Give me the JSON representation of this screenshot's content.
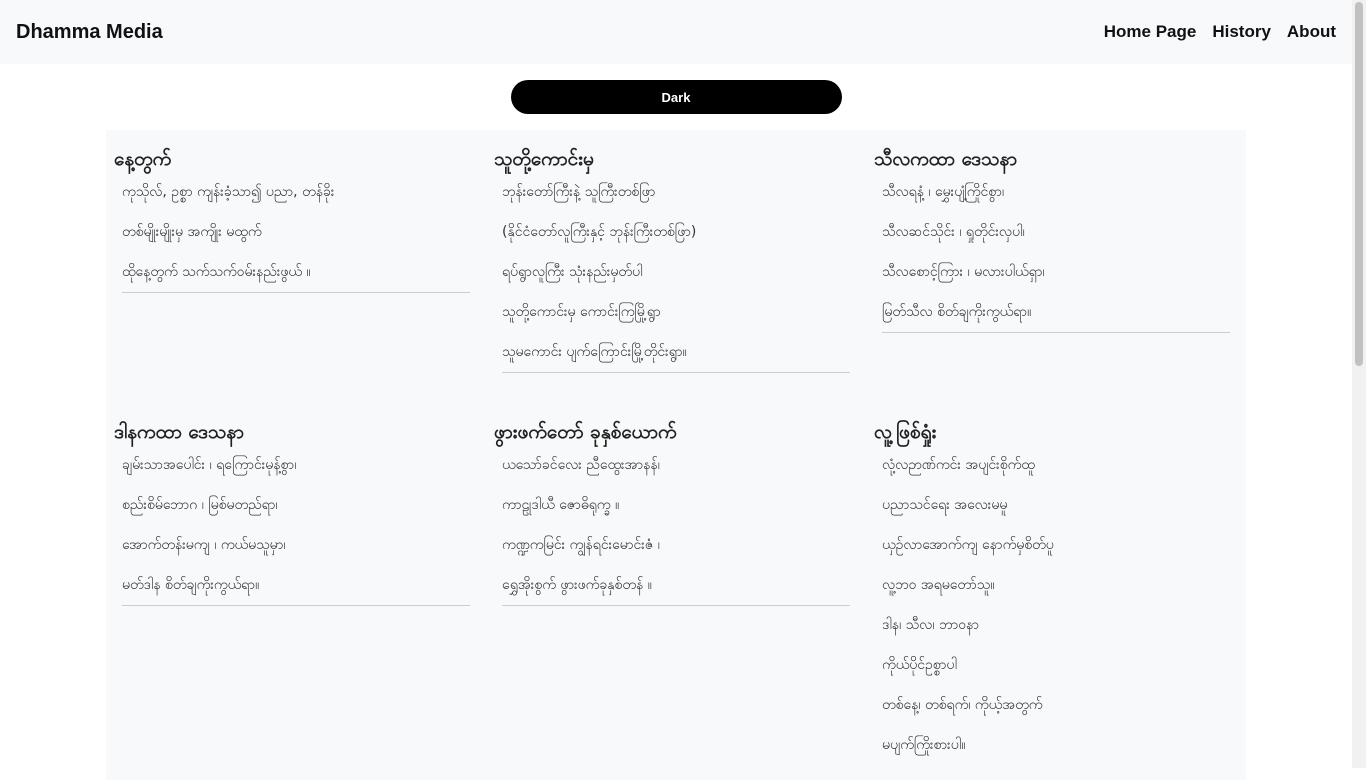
{
  "navbar": {
    "brand": "Dhamma Media",
    "links": [
      "Home Page",
      "History",
      "About"
    ]
  },
  "theme_toggle": {
    "label": "Dark"
  },
  "sections": [
    {
      "title": "နေ့တွက်",
      "items": [
        "ကုသိုလ်, ဥစ္စာ ကျန်းခံ့သာ၍ ပညာ, တန်ခိုး",
        "တစ်မျိုးမျိုးမှ အကျိုး မထွက်",
        "ထိုနေ့တွက် သက်သက်ဝမ်းနည်းဖွယ် ။"
      ]
    },
    {
      "title": "သူတို့ကောင်းမှ",
      "items": [
        "ဘုန်းတော်ကြီးနဲ့ သူကြီးတစ်ဖြာ",
        "(နိုင်ငံတော်လူကြီးနှင့် ဘုန်းကြီးတစ်ဖြာ)",
        "ရပ်ရွာလူကြီး သုံးနည်းမှတ်ပါ",
        "သူတို့ကောင်းမှ ကောင်းကြမြို့ရွာ",
        "သူမကောင်း ပျက်ကြောင်းမြို့တိုင်းရွာ။"
      ]
    },
    {
      "title": "သီလကထာ ဒေသနာ",
      "items": [
        "သီလရနံ့ ၊ မွှေးပျံ့ကြိုင်စွာ၊",
        "သီလဆင်သိုင်း ၊ ရှုတိုင်းလှပါ၊",
        "သီလစောင့်ကြား ၊ မလားပါယ်ရှာ၊",
        "မြတ်သီလ စိတ်ချကိုးကွယ်ရာ။"
      ]
    },
    {
      "title": "ဒါနကထာ ဒေသနာ",
      "items": [
        "ချမ်းသာအပေါင်း ၊ ရကြောင်းမုန့်စွာ၊",
        "စည်းစိမ်ဘောဂ ၊ မြစ်မတည်ရာ၊",
        "အောက်တန်းမကျ ၊ ကယ်မသူမှာ၊",
        "မတ်ဒါန စိတ်ချကိုးကွယ်ရာ။"
      ]
    },
    {
      "title": "ဖွားဖက်တော် ခုနှစ်ယောက်",
      "items": [
        "ယသော်ခင်လေး ညီထွေးအာနန်၊",
        "ကာဠုဒါယီ ဇောဓိရုက္ခ ။",
        "ကဏ္ဍကမြင်း ကျွန်ရင်းမောင်းဇံ ၊",
        "ရွှေအိုးစွက် ဖွားဖက်ခုနှစ်တန် ။"
      ]
    },
    {
      "title": "လူ့ဖြစ်ရှုံး",
      "items": [
        "လုံ့လဉာဏ်ကင်း အပျင်းစိုက်ထူ",
        "ပညာသင်ရေး အလေးမမူ",
        "ယှဉ်လာအောက်ကျ နောက်မှစိတ်ပူ",
        "လူ့ဘဝ အရမတော်သူ။",
        "ဒါန၊ သီလ၊ ဘာဝနာ",
        "ကိုယ်ပိုင်ဥစ္စာပါ",
        "တစ်နေ့၊ တစ်ရက်၊ ကိုယ့်အတွက်",
        "မပျက်ကြိုးစားပါ။"
      ]
    }
  ]
}
